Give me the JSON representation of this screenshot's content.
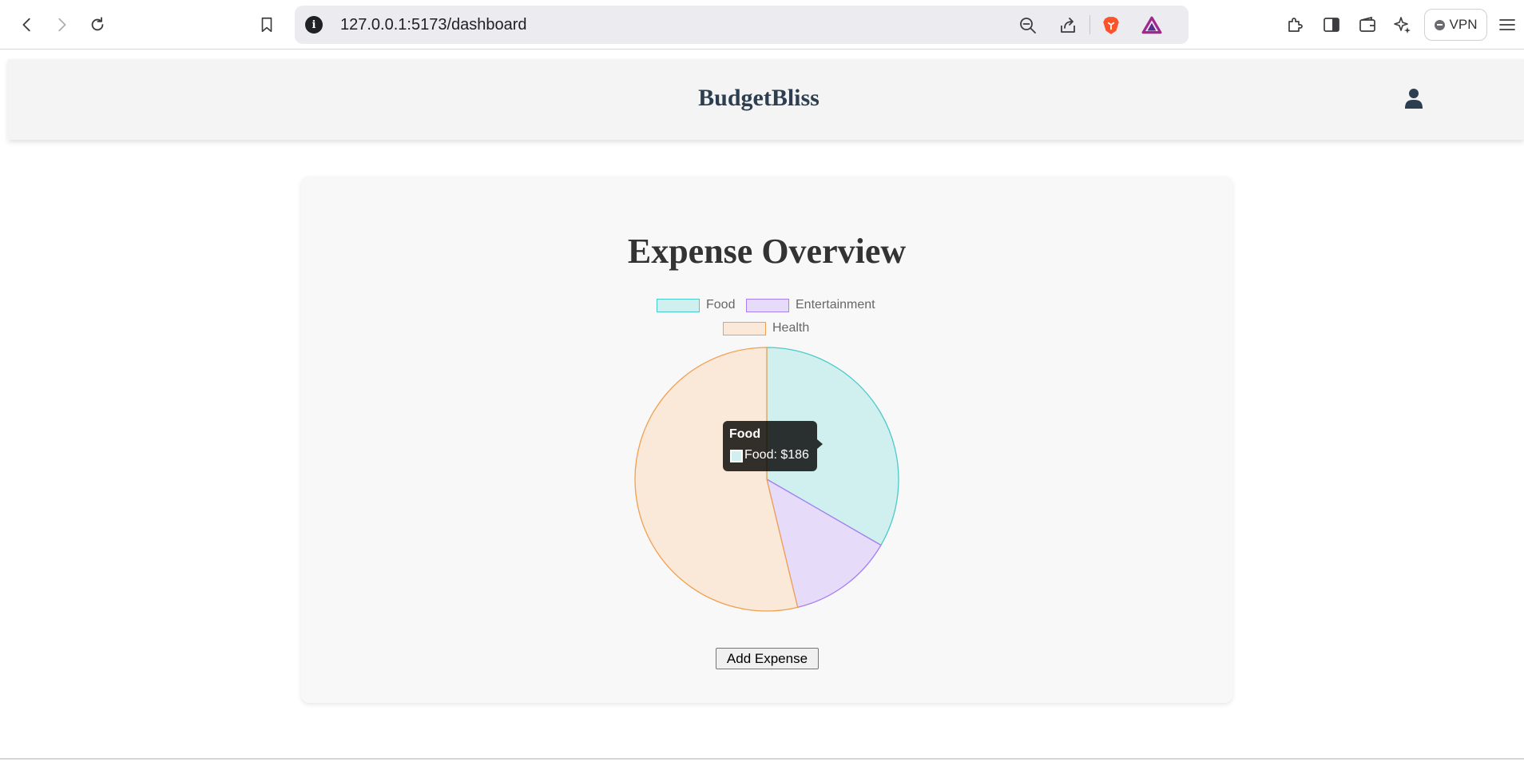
{
  "browser": {
    "url": "127.0.0.1:5173/dashboard",
    "vpn_label": "VPN"
  },
  "app": {
    "brand": "BudgetBliss"
  },
  "card": {
    "title": "Expense Overview",
    "add_button_label": "Add Expense"
  },
  "tooltip": {
    "title": "Food",
    "label": "Food: $186"
  },
  "chart_data": {
    "type": "pie",
    "title": "",
    "categories": [
      "Food",
      "Entertainment",
      "Health"
    ],
    "values": [
      186,
      72,
      300
    ],
    "legend_position": "top",
    "colors": {
      "Food": {
        "fill": "#d0f0f0",
        "stroke": "#4cc9c9"
      },
      "Entertainment": {
        "fill": "#e6dcfa",
        "stroke": "#a67ff0"
      },
      "Health": {
        "fill": "#fae8d8",
        "stroke": "#f0a050"
      }
    }
  }
}
